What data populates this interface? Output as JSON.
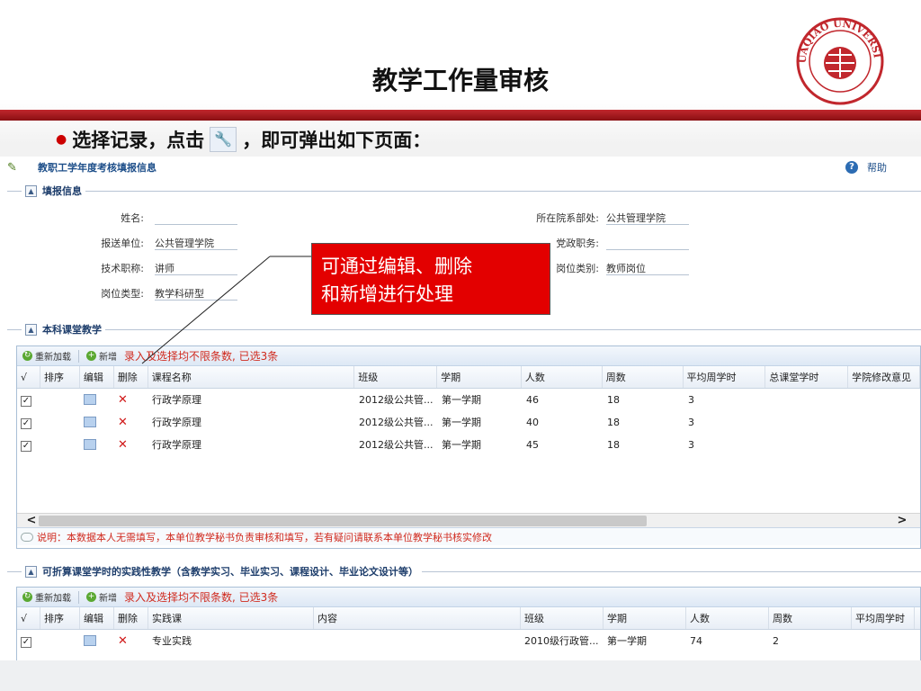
{
  "slide": {
    "title": "教学工作量审核",
    "bullet_text_before": "选择记录，点击",
    "bullet_text_after": "，即可弹出如下页面：",
    "callout_line1": "可通过编辑、删除",
    "callout_line2": "和新增进行处理",
    "logo_text": "HUAQIAO UNIVERSITY",
    "accent_color": "#c1272d"
  },
  "page": {
    "breadcrumb": "教职工学年度考核填报信息",
    "help_label": "帮助"
  },
  "fill_info": {
    "section_title": "填报信息",
    "fields": [
      {
        "label": "姓名:",
        "value": ""
      },
      {
        "label": "所在院系部处:",
        "value": "公共管理学院"
      },
      {
        "label": "报送单位:",
        "value": "公共管理学院"
      },
      {
        "label": "党政职务:",
        "value": ""
      },
      {
        "label": "技术职称:",
        "value": "讲师"
      },
      {
        "label": "岗位类别:",
        "value": "教师岗位"
      },
      {
        "label": "岗位类型:",
        "value": "教学科研型"
      }
    ]
  },
  "undergrad": {
    "section_title": "本科课堂教学",
    "toolbar": {
      "reload": "重新加载",
      "add": "新增",
      "note": "录入及选择均不限条数, 已选3条"
    },
    "columns": [
      "√",
      "排序",
      "编辑",
      "删除",
      "课程名称",
      "班级",
      "学期",
      "人数",
      "周数",
      "平均周学时",
      "总课堂学时",
      "学院修改意见"
    ],
    "rows": [
      {
        "course": "行政学原理",
        "class": "2012级公共管...",
        "term": "第一学期",
        "count": "46",
        "weeks": "18",
        "avg": "3"
      },
      {
        "course": "行政学原理",
        "class": "2012级公共管...",
        "term": "第一学期",
        "count": "40",
        "weeks": "18",
        "avg": "3"
      },
      {
        "course": "行政学原理",
        "class": "2012级公共管...",
        "term": "第一学期",
        "count": "45",
        "weeks": "18",
        "avg": "3"
      }
    ],
    "explain": "说明：本数据本人无需填写，本单位教学秘书负责审核和填写，若有疑问请联系本单位教学秘书核实修改"
  },
  "practice": {
    "section_title": "可折算课堂学时的实践性教学（含教学实习、毕业实习、课程设计、毕业论文设计等）",
    "toolbar": {
      "reload": "重新加载",
      "add": "新增",
      "note": "录入及选择均不限条数, 已选3条"
    },
    "columns": [
      "√",
      "排序",
      "编辑",
      "删除",
      "实践课",
      "内容",
      "班级",
      "学期",
      "人数",
      "周数",
      "平均周学时"
    ],
    "rows": [
      {
        "course": "专业实践",
        "content": "",
        "class": "2010级行政管...",
        "term": "第一学期",
        "count": "74",
        "weeks": "2"
      }
    ]
  },
  "icons": {
    "breadcrumb": "user-edit-icon",
    "help": "help-icon",
    "collapse": "collapse-icon",
    "reload": "reload-icon",
    "add": "add-icon",
    "edit": "edit-icon",
    "delete": "delete-icon",
    "tool": "wrench-icon"
  }
}
